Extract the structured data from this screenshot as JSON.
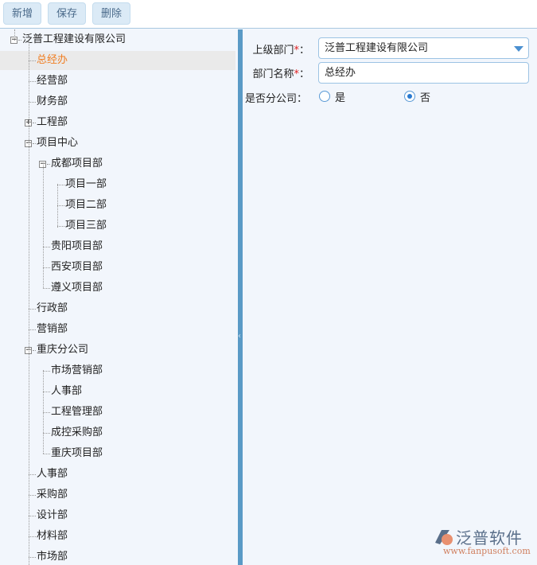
{
  "toolbar": {
    "add": "新增",
    "save": "保存",
    "delete": "删除"
  },
  "tree": [
    {
      "label": "泛普工程建设有限公司",
      "level": 0,
      "exp": "-"
    },
    {
      "label": "总经办",
      "level": 1,
      "selected": true
    },
    {
      "label": "经营部",
      "level": 1
    },
    {
      "label": "财务部",
      "level": 1
    },
    {
      "label": "工程部",
      "level": 1,
      "exp": "+"
    },
    {
      "label": "项目中心",
      "level": 1,
      "exp": "-"
    },
    {
      "label": "成都项目部",
      "level": 2,
      "exp": "-"
    },
    {
      "label": "项目一部",
      "level": 3
    },
    {
      "label": "项目二部",
      "level": 3
    },
    {
      "label": "项目三部",
      "level": 3
    },
    {
      "label": "贵阳项目部",
      "level": 2
    },
    {
      "label": "西安项目部",
      "level": 2
    },
    {
      "label": "遵义项目部",
      "level": 2
    },
    {
      "label": "行政部",
      "level": 1
    },
    {
      "label": "营销部",
      "level": 1
    },
    {
      "label": "重庆分公司",
      "level": 1,
      "exp": "-"
    },
    {
      "label": "市场营销部",
      "level": 2
    },
    {
      "label": "人事部",
      "level": 2
    },
    {
      "label": "工程管理部",
      "level": 2
    },
    {
      "label": "成控采购部",
      "level": 2
    },
    {
      "label": "重庆项目部",
      "level": 2
    },
    {
      "label": "人事部",
      "level": 1
    },
    {
      "label": "采购部",
      "level": 1
    },
    {
      "label": "设计部",
      "level": 1
    },
    {
      "label": "材料部",
      "level": 1
    },
    {
      "label": "市场部",
      "level": 1
    }
  ],
  "form": {
    "parent_label": "上级部门",
    "parent_value": "泛普工程建设有限公司",
    "name_label": "部门名称",
    "name_value": "总经办",
    "required_mark": "*",
    "colon": "：",
    "branch_label": "是否分公司：",
    "yes": "是",
    "no": "否",
    "branch_value": "否"
  },
  "logo": {
    "brand": "泛普软件",
    "url": "www.fanpusoft.com"
  }
}
